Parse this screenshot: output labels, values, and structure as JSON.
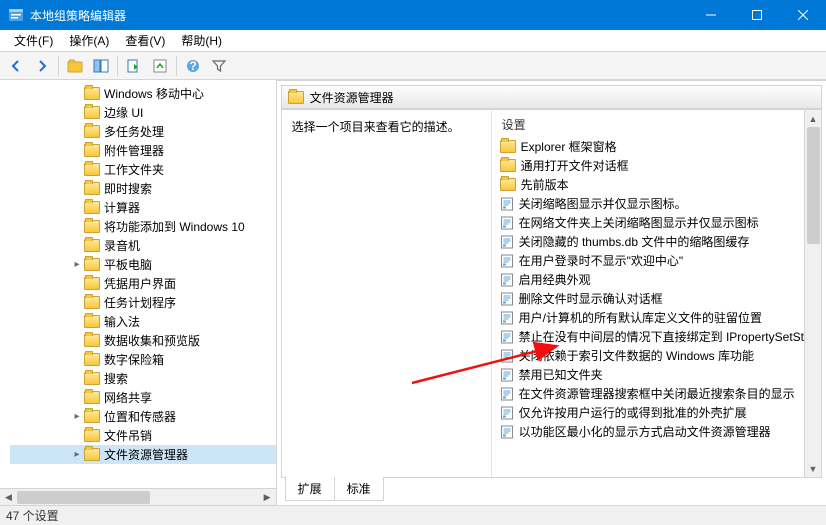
{
  "window": {
    "title": "本地组策略编辑器"
  },
  "menu": {
    "file": "文件(F)",
    "action": "操作(A)",
    "view": "查看(V)",
    "help": "帮助(H)"
  },
  "tree": {
    "items": [
      {
        "label": "Windows 移动中心",
        "twist": ""
      },
      {
        "label": "边缘 UI",
        "twist": ""
      },
      {
        "label": "多任务处理",
        "twist": ""
      },
      {
        "label": "附件管理器",
        "twist": ""
      },
      {
        "label": "工作文件夹",
        "twist": ""
      },
      {
        "label": "即时搜索",
        "twist": ""
      },
      {
        "label": "计算器",
        "twist": ""
      },
      {
        "label": "将功能添加到 Windows 10",
        "twist": ""
      },
      {
        "label": "录音机",
        "twist": ""
      },
      {
        "label": "平板电脑",
        "twist": "▸"
      },
      {
        "label": "凭据用户界面",
        "twist": ""
      },
      {
        "label": "任务计划程序",
        "twist": ""
      },
      {
        "label": "输入法",
        "twist": ""
      },
      {
        "label": "数据收集和预览版",
        "twist": ""
      },
      {
        "label": "数字保险箱",
        "twist": ""
      },
      {
        "label": "搜索",
        "twist": ""
      },
      {
        "label": "网络共享",
        "twist": ""
      },
      {
        "label": "位置和传感器",
        "twist": "▸"
      },
      {
        "label": "文件吊销",
        "twist": ""
      },
      {
        "label": "文件资源管理器",
        "twist": "▸",
        "selected": true
      }
    ]
  },
  "right": {
    "header": "文件资源管理器",
    "desc": "选择一个项目来查看它的描述。",
    "list_header": "设置",
    "folders": [
      "Explorer 框架窗格",
      "通用打开文件对话框",
      "先前版本"
    ],
    "policies": [
      "关闭缩略图显示并仅显示图标。",
      "在网络文件夹上关闭缩略图显示并仅显示图标",
      "关闭隐藏的 thumbs.db 文件中的缩略图缓存",
      "在用户登录时不显示\"欢迎中心\"",
      "启用经典外观",
      "删除文件时显示确认对话框",
      "用户/计算机的所有默认库定义文件的驻留位置",
      "禁止在没有中间层的情况下直接绑定到 IPropertySetSt",
      "关闭依赖于索引文件数据的 Windows 库功能",
      "禁用已知文件夹",
      "在文件资源管理器搜索框中关闭最近搜索条目的显示",
      "仅允许按用户运行的或得到批准的外壳扩展",
      "以功能区最小化的显示方式启动文件资源管理器"
    ],
    "tabs": {
      "extended": "扩展",
      "standard": "标准"
    }
  },
  "status": "47 个设置"
}
